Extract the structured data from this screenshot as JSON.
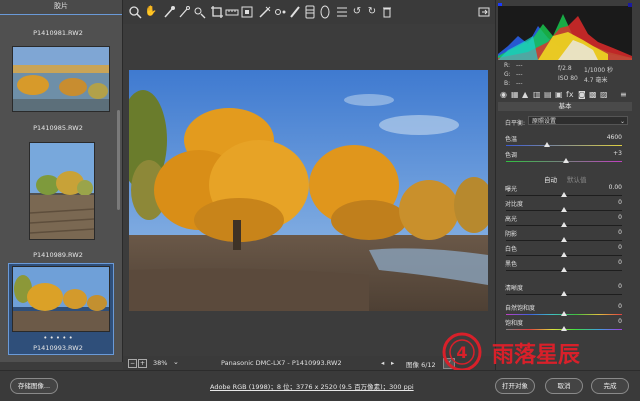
{
  "filmstrip": {
    "header": "胶片",
    "items": [
      {
        "label": "P1410981.RW2"
      },
      {
        "label": "P1410985.RW2"
      },
      {
        "label": "P1410989.RW2"
      },
      {
        "label": "P1410993.RW2",
        "stars": "• • • • •"
      }
    ]
  },
  "toolbar": {
    "tools": [
      "zoom-icon",
      "hand-icon",
      "white-balance-icon",
      "color-sampler-icon",
      "target-adjust-icon",
      "crop-icon",
      "straighten-icon",
      "transform-icon",
      "spot-removal-icon",
      "redeye-icon",
      "brush-icon",
      "graduated-filter-icon",
      "radial-filter-icon",
      "list-icon",
      "rotate-left-icon",
      "rotate-right-icon",
      "trash-icon"
    ],
    "fullscreen": "fullscreen-icon"
  },
  "canvas_footer": {
    "zoom": "38%",
    "title": "Panasonic DMC-LX7 -  P1410993.RW2",
    "image_counter": "图像 6/12"
  },
  "info": {
    "r_label": "R:",
    "g_label": "G:",
    "b_label": "B:",
    "r_value": "---",
    "g_value": "---",
    "b_value": "---",
    "aperture": "f/2.8",
    "shutter": "1/1000 秒",
    "iso": "ISO 80",
    "focal": "4.7 毫米"
  },
  "panel": {
    "title": "基本",
    "white_balance_label": "白平衡:",
    "white_balance_value": "原照设置",
    "auto_label": "自动",
    "default_label": "默认值",
    "sliders": [
      {
        "name": "temperature",
        "label": "色温",
        "value": "4600",
        "pos": 0.35
      },
      {
        "name": "tint",
        "label": "色调",
        "value": "+3",
        "pos": 0.52
      },
      {
        "name": "exposure",
        "label": "曝光",
        "value": "0.00",
        "pos": 0.5
      },
      {
        "name": "contrast",
        "label": "对比度",
        "value": "0",
        "pos": 0.5
      },
      {
        "name": "highlights",
        "label": "高光",
        "value": "0",
        "pos": 0.5
      },
      {
        "name": "shadows",
        "label": "阴影",
        "value": "0",
        "pos": 0.5
      },
      {
        "name": "whites",
        "label": "白色",
        "value": "0",
        "pos": 0.5
      },
      {
        "name": "blacks",
        "label": "黑色",
        "value": "0",
        "pos": 0.5
      },
      {
        "name": "clarity",
        "label": "清晰度",
        "value": "0",
        "pos": 0.5
      },
      {
        "name": "vibrance",
        "label": "自然饱和度",
        "value": "0",
        "pos": 0.5
      },
      {
        "name": "saturation",
        "label": "饱和度",
        "value": "0",
        "pos": 0.5
      }
    ]
  },
  "bottombar": {
    "save_label": "存储图像...",
    "workflow": "Adobe RGB (1998)；8 位；3776 x 2520 (9.5 百万像素)；300 ppi",
    "open_label": "打开对象",
    "cancel_label": "取消",
    "done_label": "完成"
  },
  "watermark": {
    "text": "雨落星辰",
    "logo": "4"
  },
  "colors": {
    "accent": "#6a9ad8",
    "watermark_red": "#d8202a"
  }
}
